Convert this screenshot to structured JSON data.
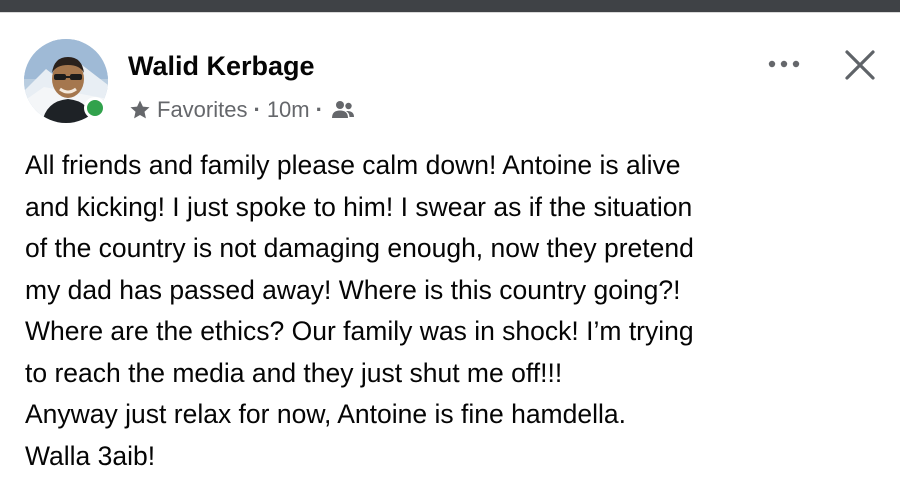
{
  "post": {
    "author": "Walid Kerbage",
    "audience_label": "Favorites",
    "timestamp": "10m",
    "separator": "·",
    "lines": [
      "All friends and family please calm down! Antoine is alive",
      "and kicking! I just spoke to him! I swear as if the situation",
      "of the country is not damaging enough, now they pretend",
      "my dad has passed away! Where is this country going?!",
      "Where are the ethics? Our family was in shock! I’m trying",
      "to reach the media and they just shut me off!!!",
      "Anyway just relax for now, Antoine is fine hamdella.",
      "Walla 3aib!"
    ]
  },
  "icons": {
    "audience": "star-icon",
    "privacy": "friends-icon",
    "menu": "more-options-icon",
    "close": "close-icon",
    "status": "online-status-dot"
  },
  "colors": {
    "online": "#31a24c",
    "meta_text": "#65676b",
    "text": "#050505"
  }
}
